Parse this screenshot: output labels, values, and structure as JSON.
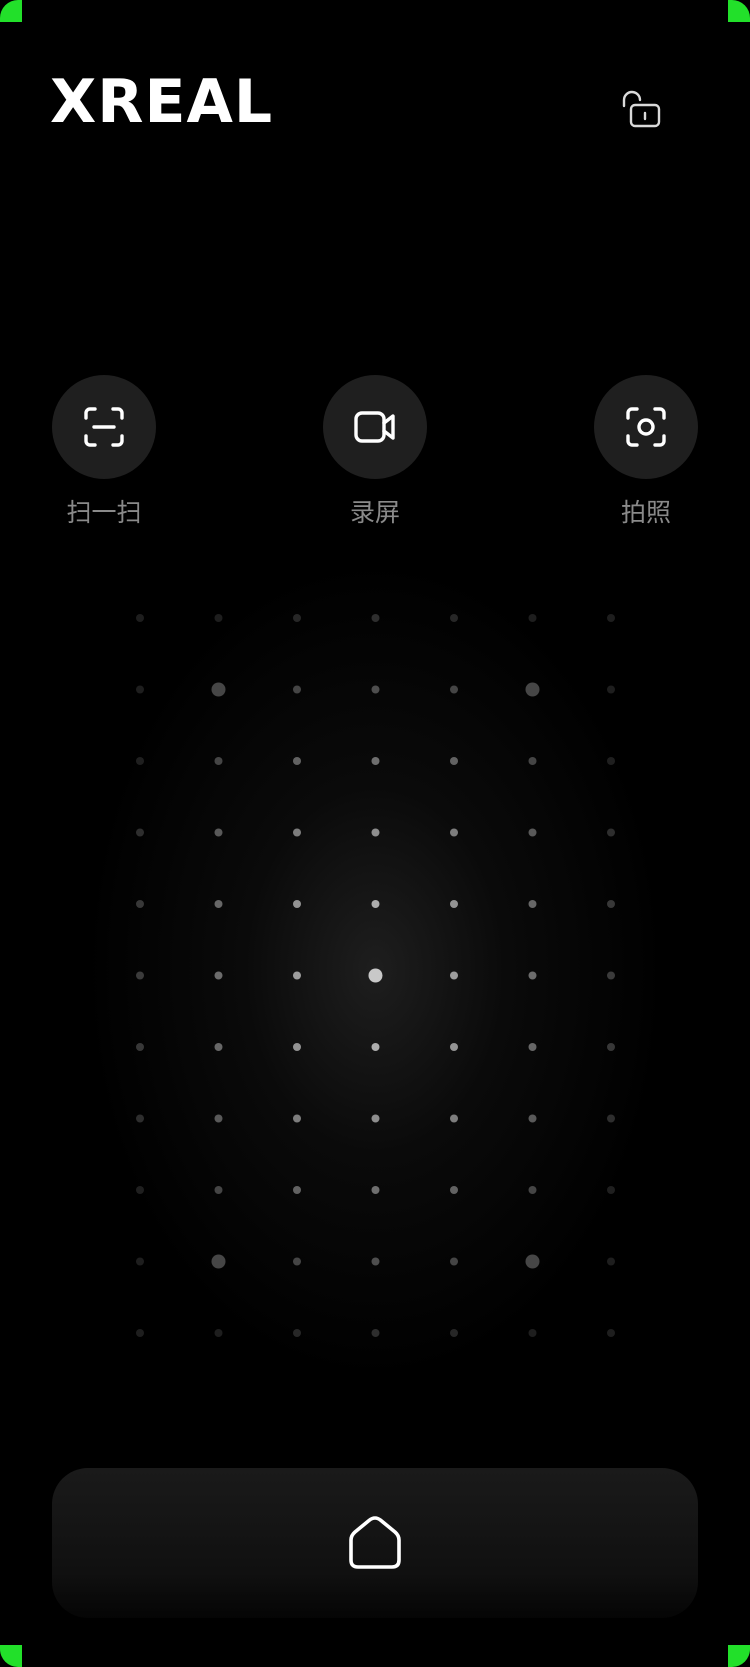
{
  "header": {
    "brand": "XREAL",
    "lock_icon": "unlocked-padlock-icon"
  },
  "actions": [
    {
      "label": "扫一扫",
      "icon": "scan-frame-icon"
    },
    {
      "label": "录屏",
      "icon": "video-camera-icon"
    },
    {
      "label": "拍照",
      "icon": "camera-focus-icon"
    }
  ],
  "touchpad": {
    "rows": 11,
    "cols": 7
  },
  "dock": {
    "home_icon": "home-icon"
  },
  "colors": {
    "background": "#000000",
    "button_fill": "#1f1f1f",
    "label": "#8a8a8a",
    "frame_corner": "#22e02a"
  }
}
